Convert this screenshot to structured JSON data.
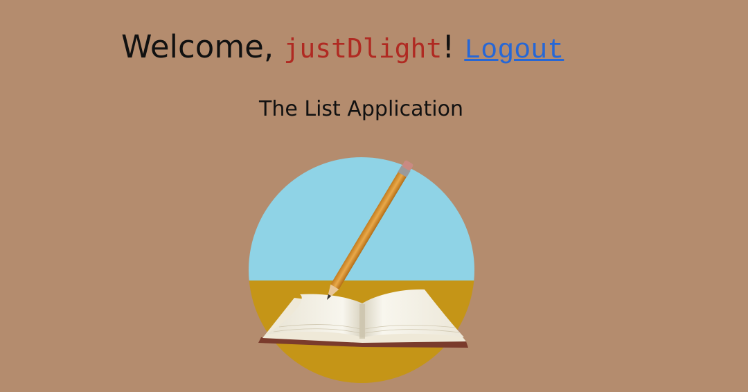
{
  "header": {
    "welcome_prefix": "Welcome, ",
    "username": "justDlight",
    "welcome_suffix": "!",
    "logout_label": "Logout"
  },
  "app": {
    "title": "The List Application"
  },
  "logo": {
    "icon": "book-and-pencil-icon",
    "sky_color": "#8fd3e6",
    "ground_color": "#c59517"
  }
}
